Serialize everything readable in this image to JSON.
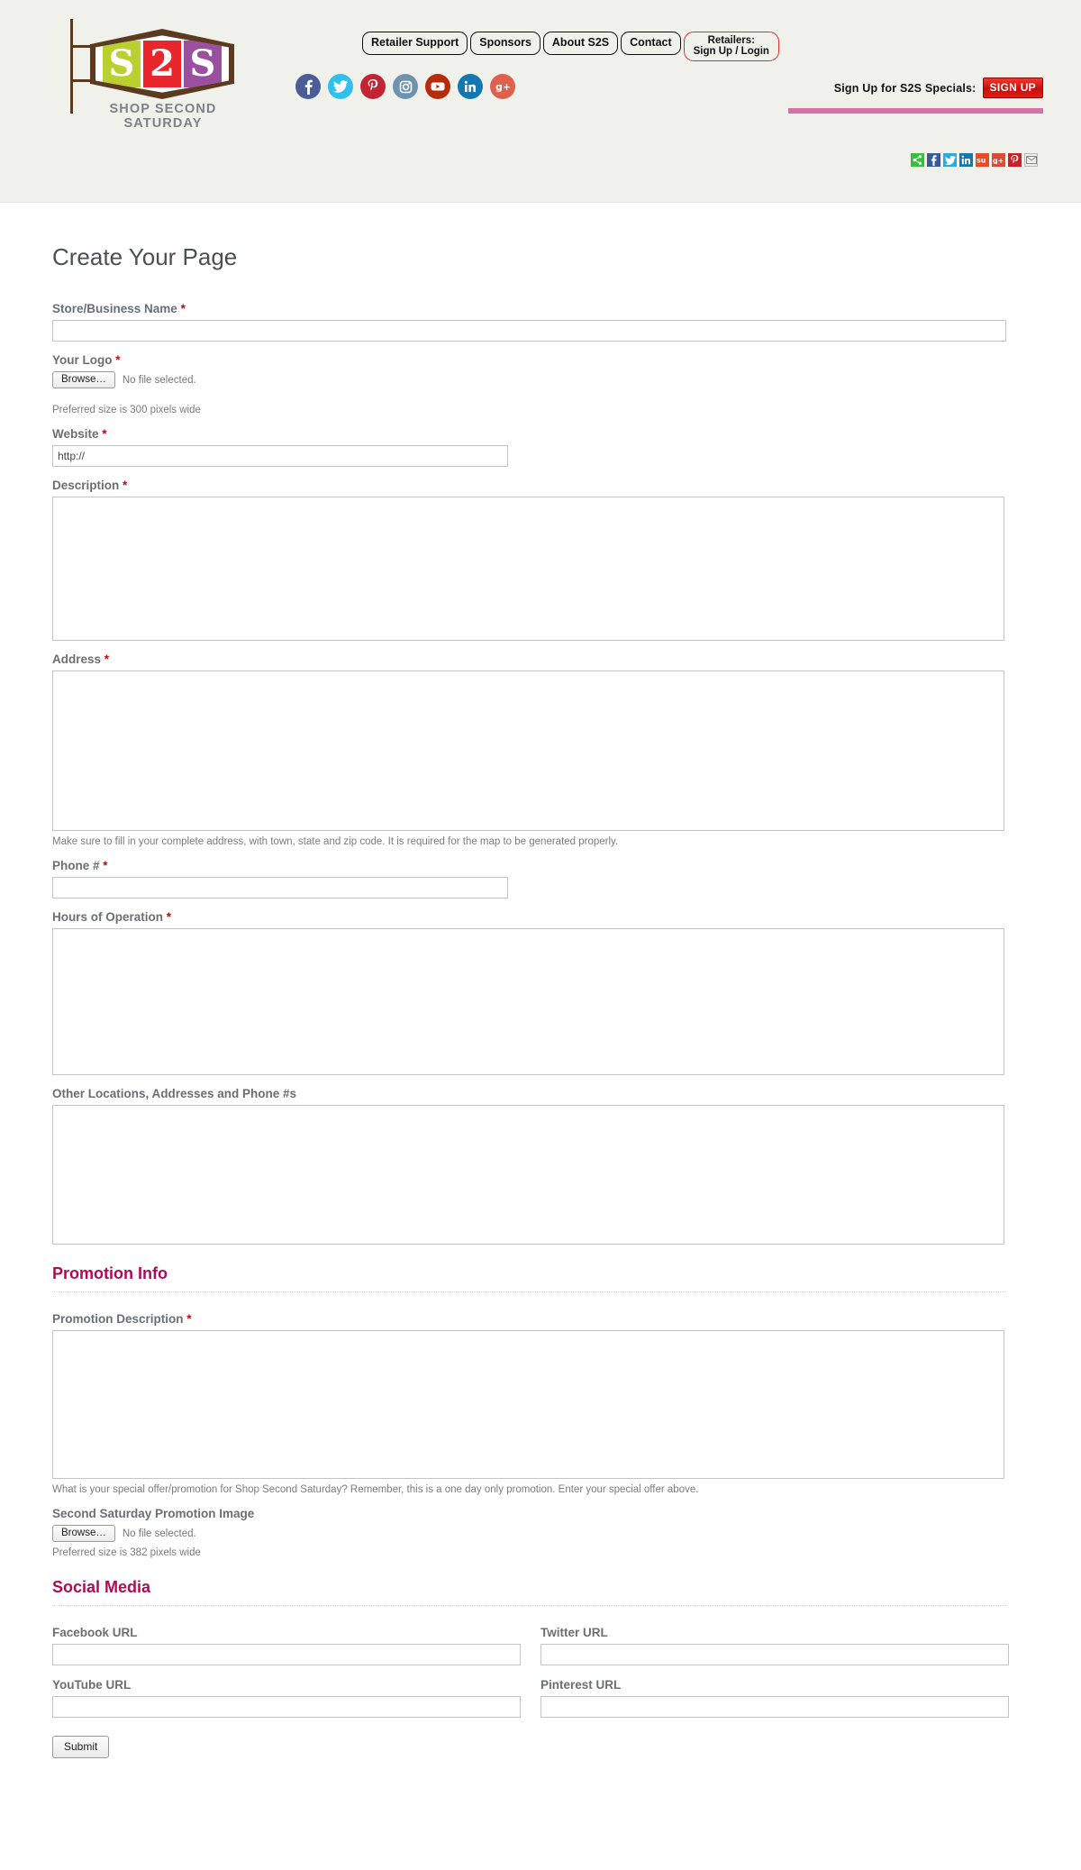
{
  "header": {
    "logo": {
      "letters": [
        "S",
        "2",
        "S"
      ],
      "tagline": "SHOP SECOND SATURDAY"
    },
    "nav": [
      {
        "label": "Retailer Support",
        "name": "nav-retailer-support"
      },
      {
        "label": "Sponsors",
        "name": "nav-sponsors"
      },
      {
        "label": "About S2S",
        "name": "nav-about-s2s"
      },
      {
        "label": "Contact",
        "name": "nav-contact"
      }
    ],
    "signup_button": {
      "line1": "Retailers:",
      "line2": "Sign Up / Login"
    },
    "socials": [
      {
        "name": "facebook-icon",
        "label": "f"
      },
      {
        "name": "twitter-icon",
        "label": "t"
      },
      {
        "name": "pinterest-icon",
        "label": "P"
      },
      {
        "name": "instagram-icon",
        "label": "ig"
      },
      {
        "name": "youtube-icon",
        "label": "yt"
      },
      {
        "name": "linkedin-icon",
        "label": "in"
      },
      {
        "name": "googleplus-icon",
        "label": "g+"
      }
    ],
    "specials": {
      "label": "Sign Up for S2S Specials:",
      "button": "SIGN UP"
    },
    "share": [
      {
        "name": "share-icon",
        "label": "≪"
      },
      {
        "name": "share-facebook-icon",
        "label": "f"
      },
      {
        "name": "share-twitter-icon",
        "label": "t"
      },
      {
        "name": "share-linkedin-icon",
        "label": "in"
      },
      {
        "name": "share-stumbleupon-icon",
        "label": "su"
      },
      {
        "name": "share-googleplus-icon",
        "label": "g+"
      },
      {
        "name": "share-pinterest-icon",
        "label": "P"
      },
      {
        "name": "share-email-icon",
        "label": "✉"
      }
    ]
  },
  "colors": {
    "header_bg": "#f1f1ec",
    "accent_pink": "#b00a56",
    "pink_rule": "#d472a8",
    "required_red": "#b00f14",
    "signup_red": "#c80d0d",
    "logo_green": "#b9d12e",
    "logo_red": "#e8262b",
    "logo_purple": "#9b4fa0",
    "logo_brown": "#5b3a20"
  },
  "form": {
    "title": "Create Your Page",
    "required_mark": "*",
    "fields": {
      "store_name": {
        "label": "Store/Business Name",
        "value": "",
        "required": true
      },
      "logo": {
        "label": "Your Logo",
        "required": true,
        "browse_label": "Browse…",
        "no_file_text": "No file selected.",
        "help": "Preferred size is 300 pixels wide"
      },
      "website": {
        "label": "Website",
        "value": "http://",
        "required": true
      },
      "description": {
        "label": "Description",
        "value": "",
        "required": true
      },
      "address": {
        "label": "Address",
        "value": "",
        "required": true,
        "help": "Make sure to fill in your complete address, with town, state and zip code. It is required for the map to be generated properly."
      },
      "phone": {
        "label": "Phone #",
        "value": "",
        "required": true
      },
      "hours": {
        "label": "Hours of Operation",
        "value": "",
        "required": true
      },
      "other_locations": {
        "label": "Other Locations, Addresses and Phone #s",
        "value": "",
        "required": false
      }
    },
    "promotion_section": {
      "heading": "Promotion Info",
      "promotion_description": {
        "label": "Promotion Description",
        "value": "",
        "required": true,
        "help": "What is your special offer/promotion for Shop Second Saturday? Remember, this is a one day only promotion. Enter your special offer above."
      },
      "promotion_image": {
        "label": "Second Saturday Promotion Image",
        "required": false,
        "browse_label": "Browse…",
        "no_file_text": "No file selected.",
        "help": "Preferred size is 382 pixels wide"
      }
    },
    "social_section": {
      "heading": "Social Media",
      "facebook": {
        "label": "Facebook URL",
        "value": ""
      },
      "twitter": {
        "label": "Twitter URL",
        "value": ""
      },
      "youtube": {
        "label": "YouTube URL",
        "value": ""
      },
      "pinterest": {
        "label": "Pinterest URL",
        "value": ""
      }
    },
    "submit_label": "Submit"
  }
}
